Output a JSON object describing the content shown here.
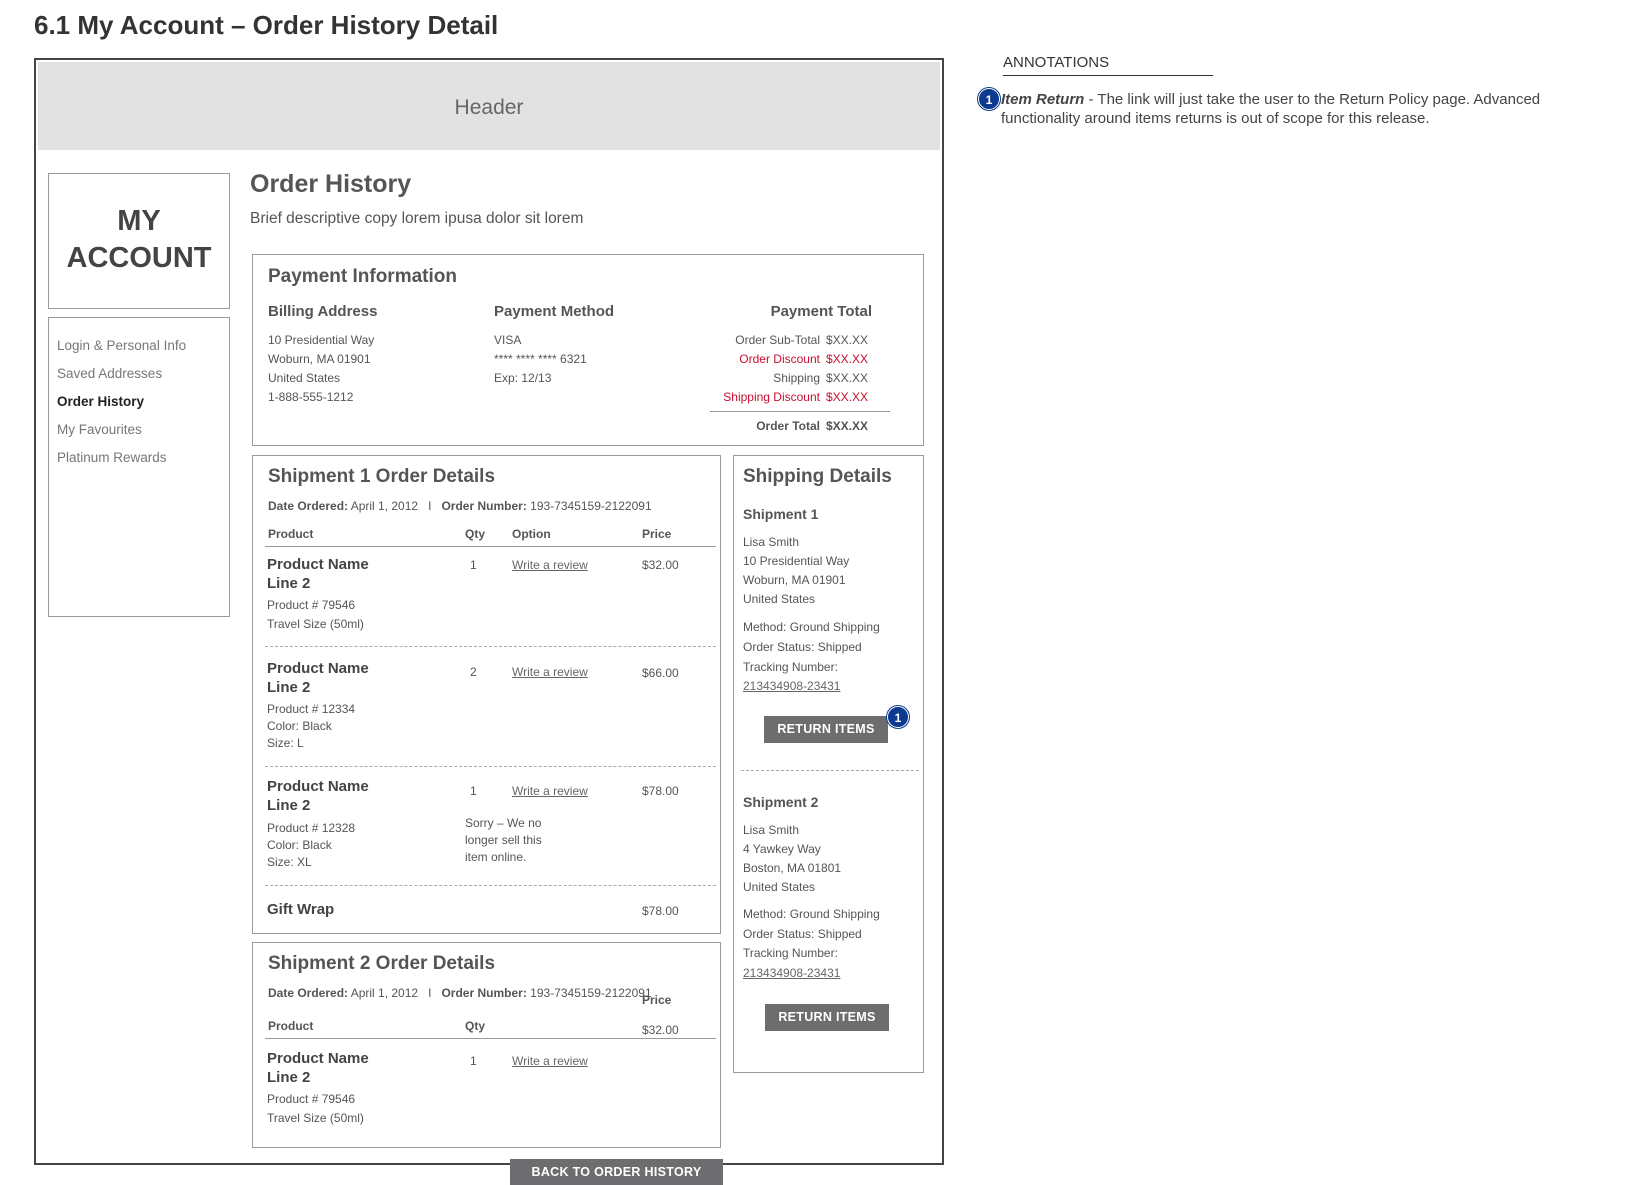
{
  "page": {
    "title": "6.1 My Account – Order History Detail"
  },
  "header": {
    "label": "Header"
  },
  "account": {
    "title_line1": "MY",
    "title_line2": "ACCOUNT",
    "nav": [
      "Login & Personal Info",
      "Saved Addresses",
      "Order History",
      "My Favourites",
      "Platinum Rewards"
    ],
    "active_nav": "Order History"
  },
  "main": {
    "title": "Order History",
    "description": "Brief descriptive copy lorem ipusa dolor sit lorem"
  },
  "payment": {
    "title": "Payment Information",
    "billing": {
      "heading": "Billing Address",
      "lines": [
        "10 Presidential Way",
        "Woburn, MA 01901",
        "United States",
        "1-888-555-1212"
      ]
    },
    "method": {
      "heading": "Payment Method",
      "lines": [
        "VISA",
        "**** **** **** 6321",
        "Exp: 12/13"
      ]
    },
    "total": {
      "heading": "Payment Total",
      "rows": [
        {
          "label": "Order Sub-Total",
          "value": "$XX.XX",
          "color": "#555555"
        },
        {
          "label": "Order Discount",
          "value": "$XX.XX",
          "color": "#c8102e"
        },
        {
          "label": "Shipping",
          "value": "$XX.XX",
          "color": "#555555"
        },
        {
          "label": "Shipping Discount",
          "value": "$XX.XX",
          "color": "#c8102e"
        }
      ],
      "grand": {
        "label": "Order Total",
        "value": "$XX.XX"
      }
    }
  },
  "shipment1": {
    "title": "Shipment 1 Order Details",
    "date_label": "Date Ordered:",
    "date_value": "April 1, 2012",
    "separator": "I",
    "order_label": "Order Number:",
    "order_value": "193-7345159-2122091",
    "columns": {
      "product": "Product",
      "qty": "Qty",
      "option": "Option",
      "price": "Price"
    },
    "items": [
      {
        "name1": "Product Name",
        "name2": "Line 2",
        "details": [
          "Product # 79546",
          "Travel Size (50ml)"
        ],
        "qty": "1",
        "option": "Write a review",
        "price": "$32.00"
      },
      {
        "name1": "Product Name",
        "name2": "Line 2",
        "details": [
          "Product # 12334",
          "Color: Black",
          "Size: L"
        ],
        "qty": "2",
        "option": "Write a review",
        "price": "$66.00"
      },
      {
        "name1": "Product Name",
        "name2": "Line 2",
        "details": [
          "Product # 12328",
          "Color: Black",
          "Size: XL"
        ],
        "qty": "1",
        "option": "Write a review",
        "note": [
          "Sorry – We no",
          "longer sell this",
          "item online."
        ],
        "price": "$78.00"
      }
    ],
    "gift": {
      "name": "Gift Wrap",
      "price": "$78.00"
    }
  },
  "shipment2": {
    "title": "Shipment 2 Order Details",
    "date_label": "Date Ordered:",
    "date_value": "April 1, 2012",
    "separator": "I",
    "order_label": "Order Number:",
    "order_value": "193-7345159-2122091",
    "columns": {
      "product": "Product",
      "qty": "Qty",
      "price": "Price"
    },
    "items": [
      {
        "name1": "Product Name",
        "name2": "Line 2",
        "details": [
          "Product # 79546",
          "Travel Size (50ml)"
        ],
        "qty": "1",
        "option": "Write a review",
        "price": "$32.00"
      }
    ]
  },
  "shipping": {
    "title": "Shipping Details",
    "s1": {
      "heading": "Shipment 1",
      "address": [
        "Lisa Smith",
        "10 Presidential Way",
        "Woburn, MA 01901",
        "United States"
      ],
      "method": "Method: Ground Shipping",
      "status": "Order Status: Shipped",
      "tracking_label": "Tracking Number:",
      "tracking": "213434908-23431",
      "button": "RETURN ITEMS"
    },
    "s2": {
      "heading": "Shipment 2",
      "address": [
        "Lisa Smith",
        "4 Yawkey Way",
        "Boston, MA 01801",
        "United States"
      ],
      "method": "Method: Ground Shipping",
      "status": "Order Status: Shipped",
      "tracking_label": "Tracking Number:",
      "tracking": "213434908-23431",
      "button": "RETURN ITEMS"
    }
  },
  "back_button": "BACK TO ORDER HISTORY",
  "annotations": {
    "title": "ANNOTATIONS",
    "items": [
      {
        "number": "1",
        "term": "Item Return",
        "text": " - The link will just take the user to the Return Policy page. Advanced functionality around items returns is out of scope for this release."
      }
    ]
  },
  "colors": {
    "accent_badge": "#0d3a8e",
    "discount": "#c8102e",
    "button": "#6d6d6f",
    "header_bg": "#e2e2e2"
  }
}
